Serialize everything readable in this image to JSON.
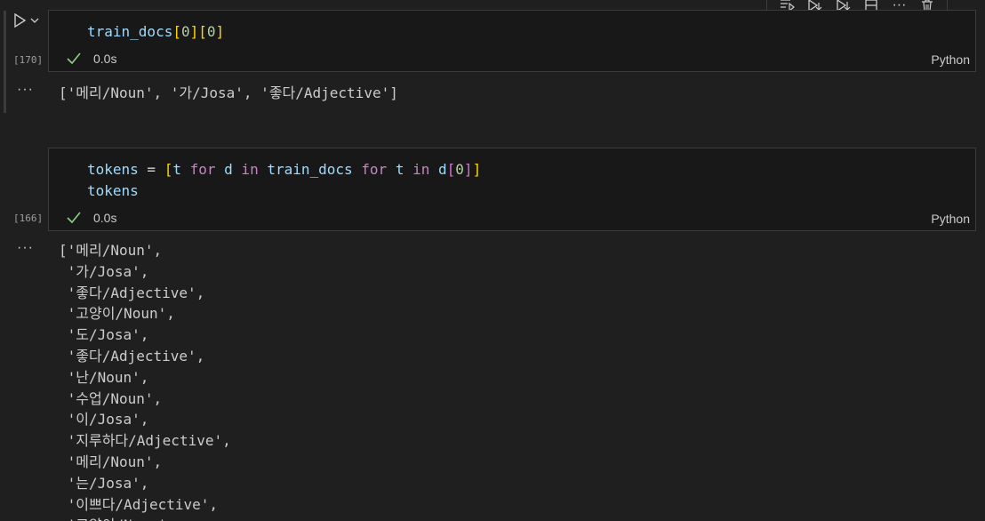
{
  "toolbar": {
    "icons": [
      "run-above-icon",
      "run-below-icon",
      "execute-below-icon",
      "split-cell-icon",
      "more-icon",
      "delete-icon"
    ],
    "more_label": "···"
  },
  "cells": [
    {
      "execution_count": "[170]",
      "code_lines": [
        [
          {
            "t": "train_docs",
            "c": "t-var"
          },
          {
            "t": "[",
            "c": "t-br1"
          },
          {
            "t": "0",
            "c": "t-num"
          },
          {
            "t": "]",
            "c": "t-br1"
          },
          {
            "t": "[",
            "c": "t-br1"
          },
          {
            "t": "0",
            "c": "t-num"
          },
          {
            "t": "]",
            "c": "t-br1"
          }
        ]
      ],
      "time": "0.0s",
      "language": "Python",
      "output_lines": [
        "['메리/Noun', '가/Josa', '좋다/Adjective']"
      ]
    },
    {
      "execution_count": "[166]",
      "code_lines": [
        [
          {
            "t": "tokens",
            "c": "t-var"
          },
          {
            "t": " = ",
            "c": "t-op"
          },
          {
            "t": "[",
            "c": "t-br1"
          },
          {
            "t": "t",
            "c": "t-var"
          },
          {
            "t": " for ",
            "c": "t-kw"
          },
          {
            "t": "d",
            "c": "t-var"
          },
          {
            "t": " in ",
            "c": "t-kw"
          },
          {
            "t": "train_docs",
            "c": "t-var"
          },
          {
            "t": " for ",
            "c": "t-kw"
          },
          {
            "t": "t",
            "c": "t-var"
          },
          {
            "t": " in ",
            "c": "t-kw"
          },
          {
            "t": "d",
            "c": "t-var"
          },
          {
            "t": "[",
            "c": "t-br2"
          },
          {
            "t": "0",
            "c": "t-num"
          },
          {
            "t": "]",
            "c": "t-br2"
          },
          {
            "t": "]",
            "c": "t-br1"
          }
        ],
        [
          {
            "t": "tokens",
            "c": "t-var"
          }
        ]
      ],
      "time": "0.0s",
      "language": "Python",
      "output_lines": [
        "['메리/Noun',",
        " '가/Josa',",
        " '좋다/Adjective',",
        " '고양이/Noun',",
        " '도/Josa',",
        " '좋다/Adjective',",
        " '난/Noun',",
        " '수업/Noun',",
        " '이/Josa',",
        " '지루하다/Adjective',",
        " '메리/Noun',",
        " '는/Josa',",
        " '이쁘다/Adjective',",
        " '고양이/Noun',"
      ]
    }
  ],
  "output_prefix": "···",
  "colors": {
    "background": "#1f1f1f",
    "cell_background": "#181818",
    "success_check": "#89d185",
    "border": "#3c3c3c"
  }
}
